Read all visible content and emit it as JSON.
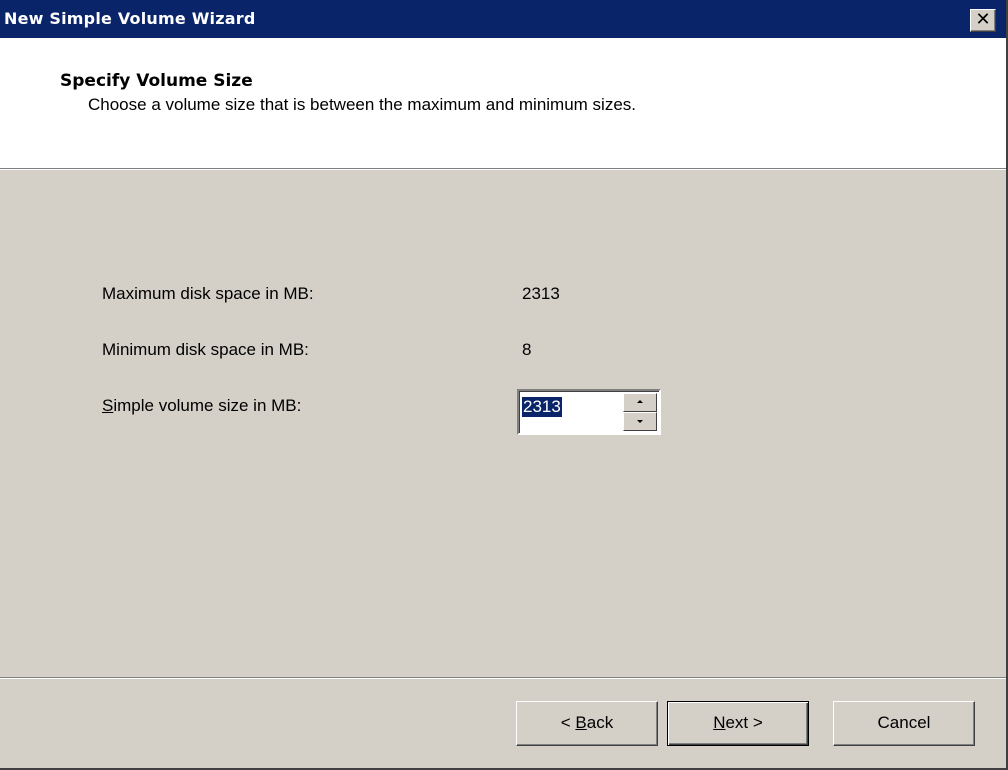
{
  "window": {
    "title": "New Simple Volume Wizard",
    "close_glyph": "✕"
  },
  "header": {
    "title": "Specify Volume Size",
    "subtitle": "Choose a volume size that is between the maximum and minimum sizes."
  },
  "fields": {
    "max": {
      "label": "Maximum disk space in MB:",
      "value": "2313"
    },
    "min": {
      "label": "Minimum disk space in MB:",
      "value": "8"
    },
    "size": {
      "label_mnemonic": "S",
      "label_rest": "imple volume size in MB:",
      "value": "2313"
    }
  },
  "buttons": {
    "back": {
      "prefix": "< ",
      "mnemonic": "B",
      "rest": "ack"
    },
    "next": {
      "mnemonic": "N",
      "rest": "ext >"
    },
    "cancel": {
      "label": "Cancel"
    }
  },
  "colors": {
    "titlebar": "#0a246a",
    "face": "#d4d0c8",
    "selection": "#0a246a"
  }
}
